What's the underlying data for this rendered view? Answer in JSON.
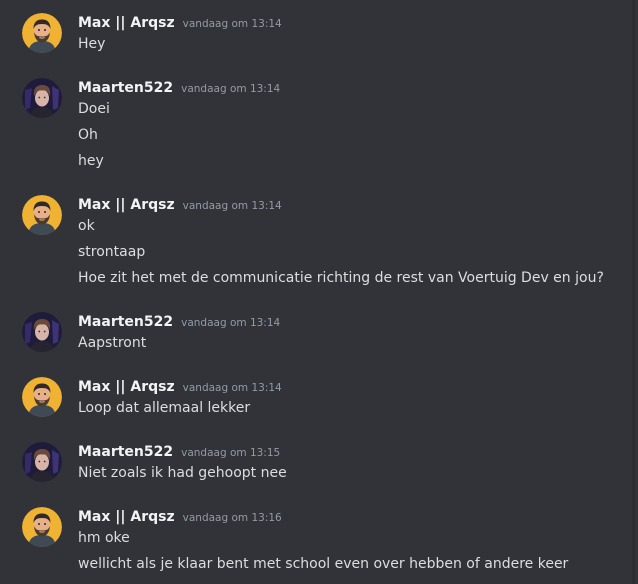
{
  "colors": {
    "background": "#313338",
    "username": "#f2f3f5",
    "timestamp": "#949ba4",
    "message": "#dbdee1",
    "avatar_max_bg": "#f0b232",
    "avatar_maarten_bg": "#1f1b3a"
  },
  "messages": [
    {
      "author": "Max || Arqsz",
      "avatar": "max-avatar-icon",
      "time": "vandaag om 13:14",
      "lines": [
        "Hey"
      ]
    },
    {
      "author": "Maarten522",
      "avatar": "maarten-avatar-icon",
      "time": "vandaag om 13:14",
      "lines": [
        "Doei",
        "Oh",
        "hey"
      ]
    },
    {
      "author": "Max || Arqsz",
      "avatar": "max-avatar-icon",
      "time": "vandaag om 13:14",
      "lines": [
        "ok",
        "strontaap",
        "Hoe zit het met de communicatie richting de rest van Voertuig Dev en jou?"
      ]
    },
    {
      "author": "Maarten522",
      "avatar": "maarten-avatar-icon",
      "time": "vandaag om 13:14",
      "lines": [
        "Aapstront"
      ]
    },
    {
      "author": "Max || Arqsz",
      "avatar": "max-avatar-icon",
      "time": "vandaag om 13:14",
      "lines": [
        "Loop dat allemaal lekker"
      ]
    },
    {
      "author": "Maarten522",
      "avatar": "maarten-avatar-icon",
      "time": "vandaag om 13:15",
      "lines": [
        "Niet zoals ik had gehoopt nee"
      ]
    },
    {
      "author": "Max || Arqsz",
      "avatar": "max-avatar-icon",
      "time": "vandaag om 13:16",
      "lines": [
        "hm oke",
        "wellicht als je klaar bent met school even over hebben of andere keer"
      ]
    }
  ]
}
